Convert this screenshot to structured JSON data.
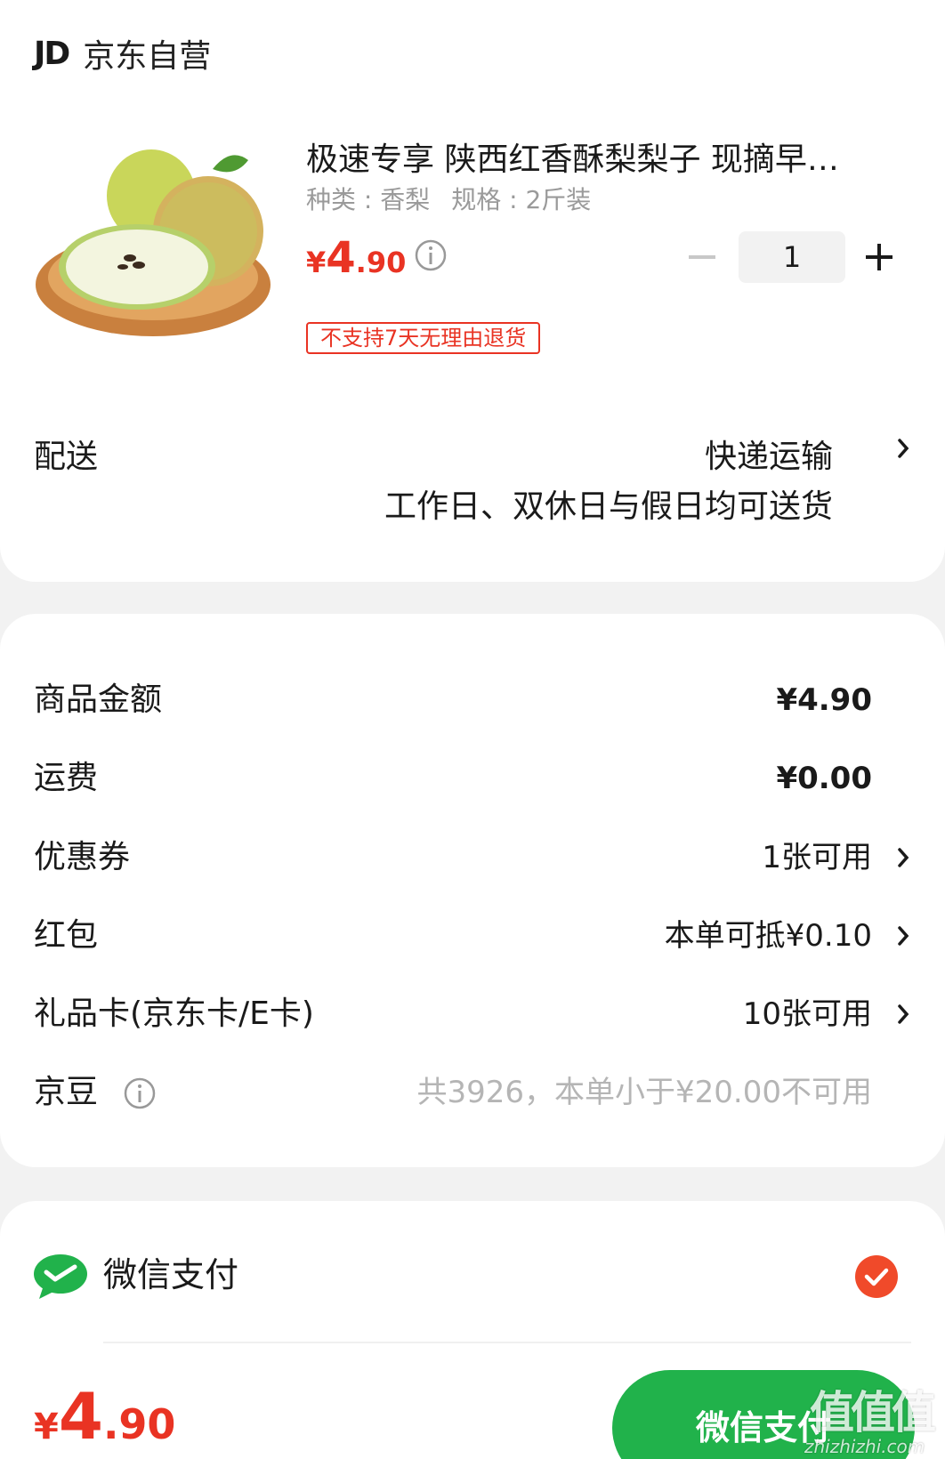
{
  "store": {
    "logo_text": "JD",
    "name": "京东自营"
  },
  "product": {
    "title": "极速专享 陕西红香酥梨梨子 现摘早…",
    "spec_kind": "种类 : 香梨",
    "spec_size": "规格 : 2斤装",
    "price_currency": "¥",
    "price_int": "4",
    "price_dec": ".90",
    "quantity": "1",
    "return_policy_tag": "不支持7天无理由退货"
  },
  "delivery": {
    "label": "配送",
    "method": "快递运输",
    "note": "工作日、双休日与假日均可送货"
  },
  "summary": {
    "goods_amount_label": "商品金额",
    "goods_amount_value": "¥4.90",
    "shipping_label": "运费",
    "shipping_value": "¥0.00",
    "coupon_label": "优惠券",
    "coupon_value": "1张可用",
    "red_packet_label": "红包",
    "red_packet_value": "本单可抵¥0.10",
    "gift_card_label": "礼品卡(京东卡/E卡)",
    "gift_card_value": "10张可用",
    "jd_beans_label": "京豆",
    "jd_beans_value": "共3926，本单小于¥20.00不可用"
  },
  "payment": {
    "method_label": "微信支付",
    "total_currency": "¥",
    "total_int": "4",
    "total_dec": ".90",
    "pay_button_label": "微信支付"
  },
  "watermark": {
    "main": "值值值",
    "sub": "zhizhizhi.com"
  },
  "colors": {
    "accent_red": "#e93323",
    "wechat_green": "#21b24b",
    "check_orange": "#f04a2a"
  }
}
